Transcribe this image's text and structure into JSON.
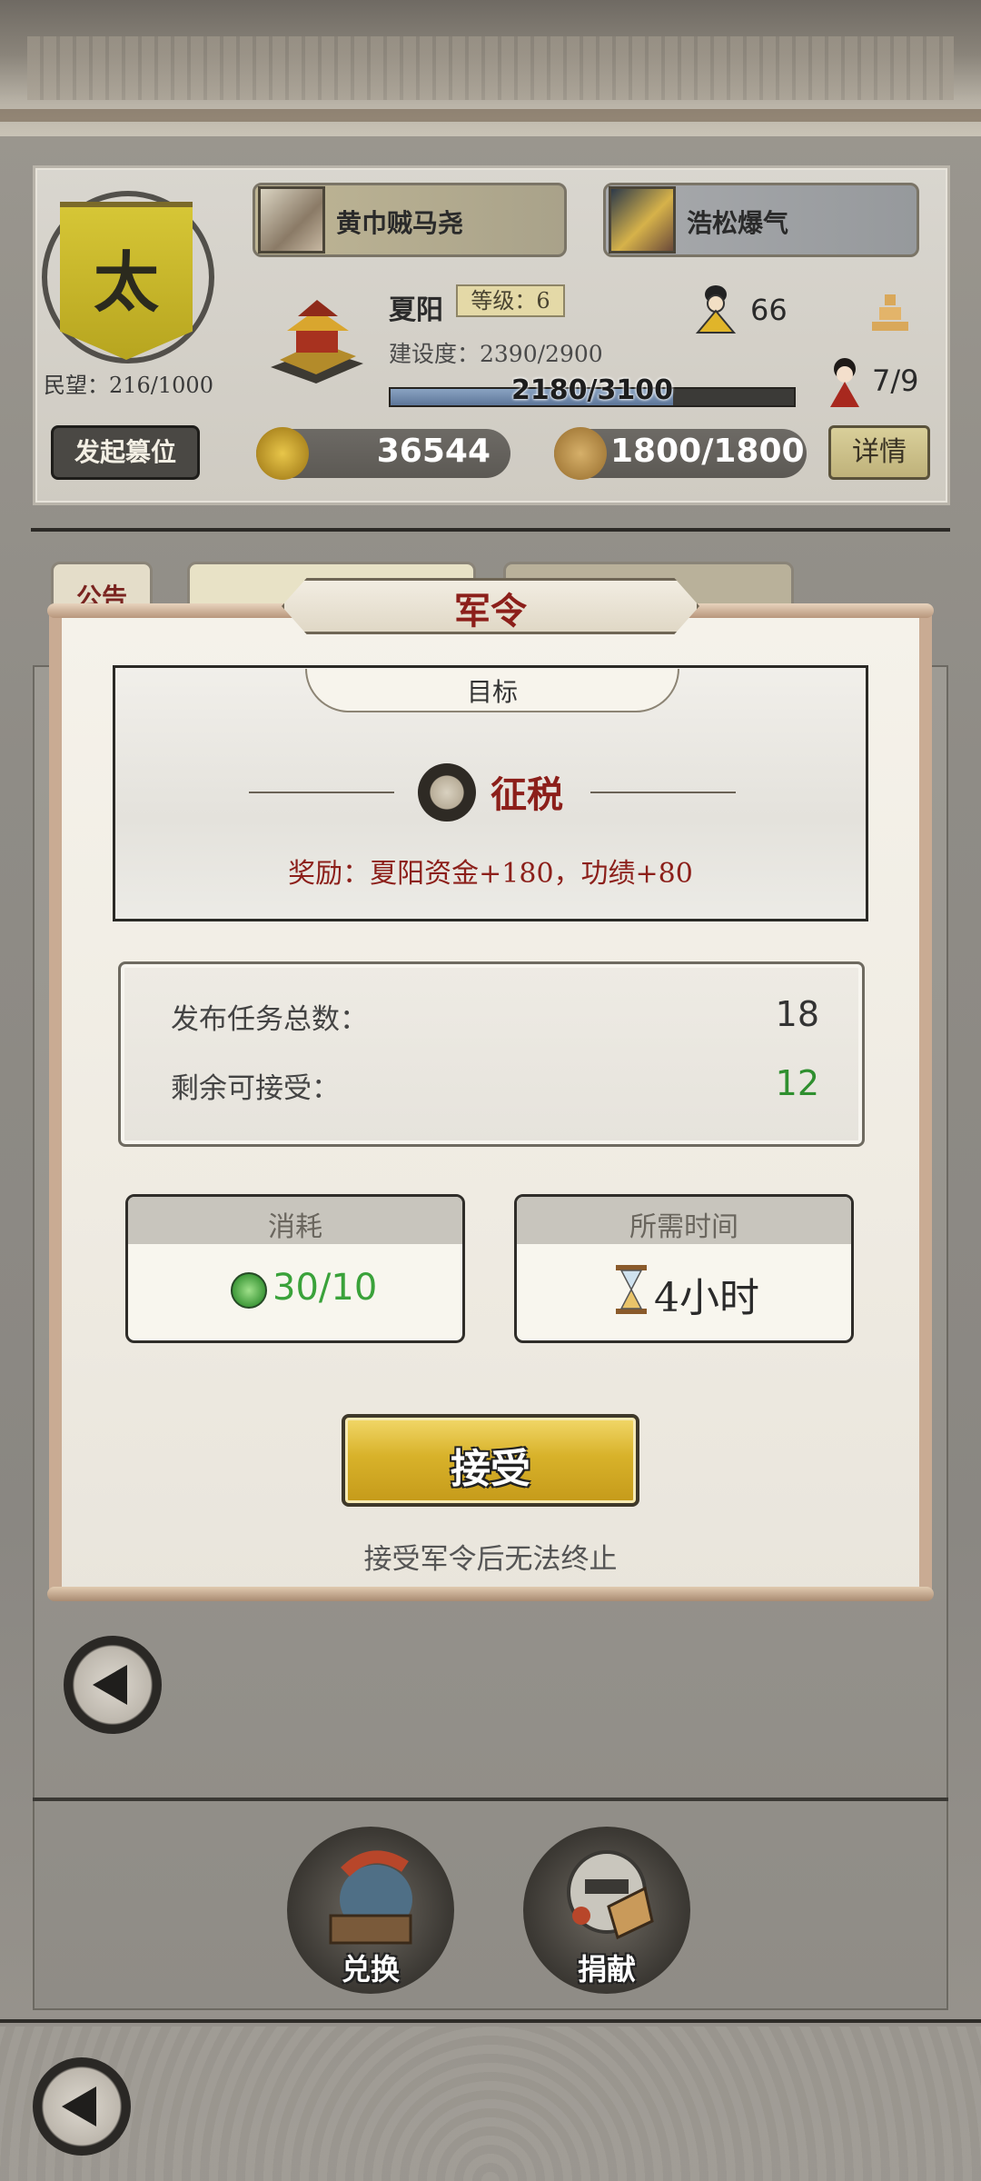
{
  "top_panel": {
    "rank_char": "太",
    "min_wang": "民望：216/1000",
    "player1_name": "黄巾贼马尧",
    "player2_name": "浩松爆气",
    "city_name": "夏阳",
    "level": "等级：6",
    "construction": "建设度：2390/2900",
    "progress_text": "2180/3100",
    "progress_fraction": 0.7,
    "officials_count": "66",
    "beauty_count": "7/9",
    "usurp_button": "发起篡位",
    "gold": "36544",
    "grain": "1800/1800",
    "detail_button": "详情"
  },
  "tabs": {
    "announcement": "公告"
  },
  "order": {
    "title": "军令",
    "target_label": "目标",
    "task_name": "征税",
    "reward": "奖励：夏阳资金+180，功绩+80",
    "total_label": "发布任务总数：",
    "total_value": "18",
    "remaining_label": "剩余可接受：",
    "remaining_value": "12",
    "cost_label": "消耗",
    "cost_value": "30/10",
    "time_label": "所需时间",
    "time_value": "4小时",
    "accept_button": "接受",
    "hint": "接受军令后无法终止"
  },
  "bottom": {
    "exchange_label": "兑换",
    "donate_label": "捐献"
  },
  "colors": {
    "title_red": "#8c1f1a",
    "remaining_green": "#2f8f2f",
    "accept_gold": "#d8b22a"
  },
  "icons": {
    "back": "back-arrow-icon",
    "task": "tax-coins-icon",
    "energy": "energy-bolt-icon",
    "time": "hourglass-icon"
  }
}
